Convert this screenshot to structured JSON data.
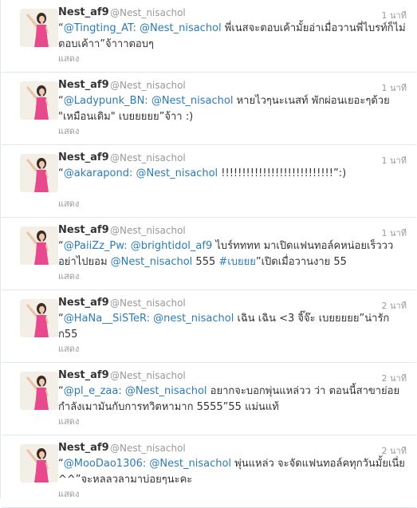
{
  "tweets": [
    {
      "name": "Nest_af9",
      "handle": "@Nest_nisachol",
      "time": "1 นาที",
      "parts": [
        {
          "t": "“",
          "link": false
        },
        {
          "t": "@Tingting_AT: @Nest_nisachol",
          "link": true
        },
        {
          "t": " พี่เนสจะตอบเค้ามั้ยอ่าเมื่อวานพี่ไบรท์ก็ไม่ตอบเค้าา”จ้าาาตอบๆ",
          "link": false
        }
      ],
      "show": "แสดง"
    },
    {
      "name": "Nest_af9",
      "handle": "@Nest_nisachol",
      "time": "1 นาที",
      "parts": [
        {
          "t": "“",
          "link": false
        },
        {
          "t": "@Ladypunk_BN: @Nest_nisachol",
          "link": true
        },
        {
          "t": " หายไวๆนะเนสท์ พักผ่อนเยอะๆด้วย \"เหมือนเดิม\" เบยยยยย”จ้าา :)",
          "link": false
        }
      ],
      "show": "แสดง"
    },
    {
      "name": "Nest_af9",
      "handle": "@Nest_nisachol",
      "time": "1 นาที",
      "parts": [
        {
          "t": "“",
          "link": false
        },
        {
          "t": "@akarapond: @Nest_nisachol",
          "link": true
        },
        {
          "t": " !!!!!!!!!!!!!!!!!!!!!!!!!!!”:)",
          "link": false
        }
      ],
      "show": "แสดง"
    },
    {
      "name": "Nest_af9",
      "handle": "@Nest_nisachol",
      "time": "1 นาที",
      "parts": [
        {
          "t": "“",
          "link": false
        },
        {
          "t": "@PaiiZz_Pw: @brightidol_af9",
          "link": true
        },
        {
          "t": " ไบร์ทททท มาเปิดแฟนทอล์คหน่อยเร็ววว อย่าไปยอม ",
          "link": false
        },
        {
          "t": "@Nest_nisachol",
          "link": true
        },
        {
          "t": " 555 ",
          "link": false
        },
        {
          "t": "#เบยยย",
          "link": true
        },
        {
          "t": "”เปิดเมื่อวานงาย 55",
          "link": false
        }
      ],
      "show": "แสดง"
    },
    {
      "name": "Nest_af9",
      "handle": "@Nest_nisachol",
      "time": "2 นาที",
      "parts": [
        {
          "t": "“",
          "link": false
        },
        {
          "t": "@HaNa__SiSTeR: @nest_nisachol",
          "link": true
        },
        {
          "t": " เฉิน เฉิน <3 จิ๊จ๊ะ เบยยยยย”น่ารักก55",
          "link": false
        }
      ],
      "show": "แสดง"
    },
    {
      "name": "Nest_af9",
      "handle": "@Nest_nisachol",
      "time": "2 นาที",
      "parts": [
        {
          "t": "“",
          "link": false
        },
        {
          "t": "@pl_e_zaa: @Nest_nisachol",
          "link": true
        },
        {
          "t": " อยากจะบอกพุ่นแหล่วว ว่า ตอนนี้สาขาย่อยกำลังเมามันกับการทวิตหามาก 5555”55 แม่นแท้",
          "link": false
        }
      ],
      "show": "แสดง"
    },
    {
      "name": "Nest_af9",
      "handle": "@Nest_nisachol",
      "time": "2 นาที",
      "parts": [
        {
          "t": "“",
          "link": false
        },
        {
          "t": "@MooDao1306: @Nest_nisachol",
          "link": true
        },
        {
          "t": " พุ่นแหล่ว จะจัดแฟนทอล์คทุกวันมั้ยเนี่ย ^^”จะหลลวลามาบ่อยๆนะคะ",
          "link": false
        }
      ],
      "show": "แสดง"
    }
  ],
  "colors": {
    "name": "#333333",
    "meta": "#999999",
    "link": "#2b7bb9",
    "border": "#e1e8ed",
    "avatar_dress": "#e8488c"
  }
}
